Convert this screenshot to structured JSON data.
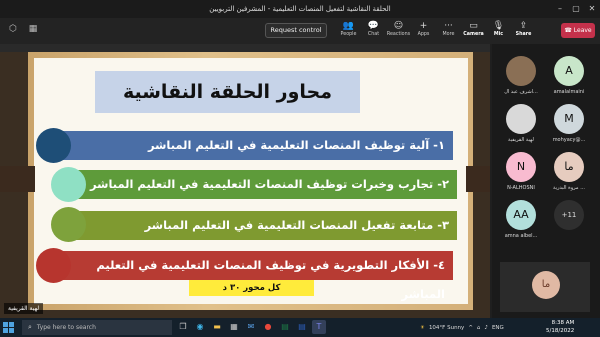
{
  "window": {
    "title": "الحلقة النقاشية لتفعيل المنصات التعليمية - المشرفين التربويين"
  },
  "toolbar": {
    "request_control": "Request control",
    "buttons": [
      {
        "label": "People",
        "icon": "people-icon",
        "glyph": "👥"
      },
      {
        "label": "Chat",
        "icon": "chat-icon",
        "glyph": "💬"
      },
      {
        "label": "Reactions",
        "icon": "reactions-icon",
        "glyph": "☺"
      },
      {
        "label": "Apps",
        "icon": "apps-icon",
        "glyph": "+"
      },
      {
        "label": "More",
        "icon": "more-icon",
        "glyph": "···"
      },
      {
        "label": "Camera",
        "icon": "camera-icon",
        "glyph": "▭"
      },
      {
        "label": "Mic",
        "icon": "mic-icon",
        "glyph": "🎙"
      },
      {
        "label": "Share",
        "icon": "share-icon",
        "glyph": "⇪"
      }
    ],
    "leave": "Leave"
  },
  "slide": {
    "title": "محاور الحلقة النقاشية",
    "items": [
      "١- آلية توظيف المنصات التعليمية في التعليم المباشر",
      "٢- تجارب وخبرات توظيف المنصات التعليمية في التعليم المباشر",
      "٣- متابعة تفعيل المنصات التعليمية في التعليم المباشر",
      "٤- الأفكار التطويرية في توظيف المنصات التعليمية في التعليم المباشر"
    ],
    "time_note": "كل محور ٣٠ د",
    "presenter": "لهية القريفية"
  },
  "participants": [
    {
      "initials": "",
      "name": "أشرف عبد ال...",
      "color": "#8a6f55"
    },
    {
      "initials": "A",
      "name": "amalalmaini",
      "color": "#c8e6c9"
    },
    {
      "initials": "",
      "name": "لهية القريفية",
      "color": "#d9d9d9"
    },
    {
      "initials": "M",
      "name": "mohyacy@...",
      "color": "#cfd8dc"
    },
    {
      "initials": "N",
      "name": "N-ALHOSNI",
      "color": "#f8bbd0"
    },
    {
      "initials": "ما",
      "name": "مروة البدرية ...",
      "color": "#e6ccbf"
    },
    {
      "initials": "AA",
      "name": "amna albel...",
      "color": "#b2dfdb"
    },
    {
      "initials": "+11",
      "name": "",
      "color": "#2f2f2f"
    }
  ],
  "self_view": {
    "initials": "ما"
  },
  "taskbar": {
    "search_placeholder": "Type here to search",
    "weather": "104°F  Sunny",
    "language": "ENG",
    "time": "8:38 AM",
    "date": "5/18/2022"
  }
}
